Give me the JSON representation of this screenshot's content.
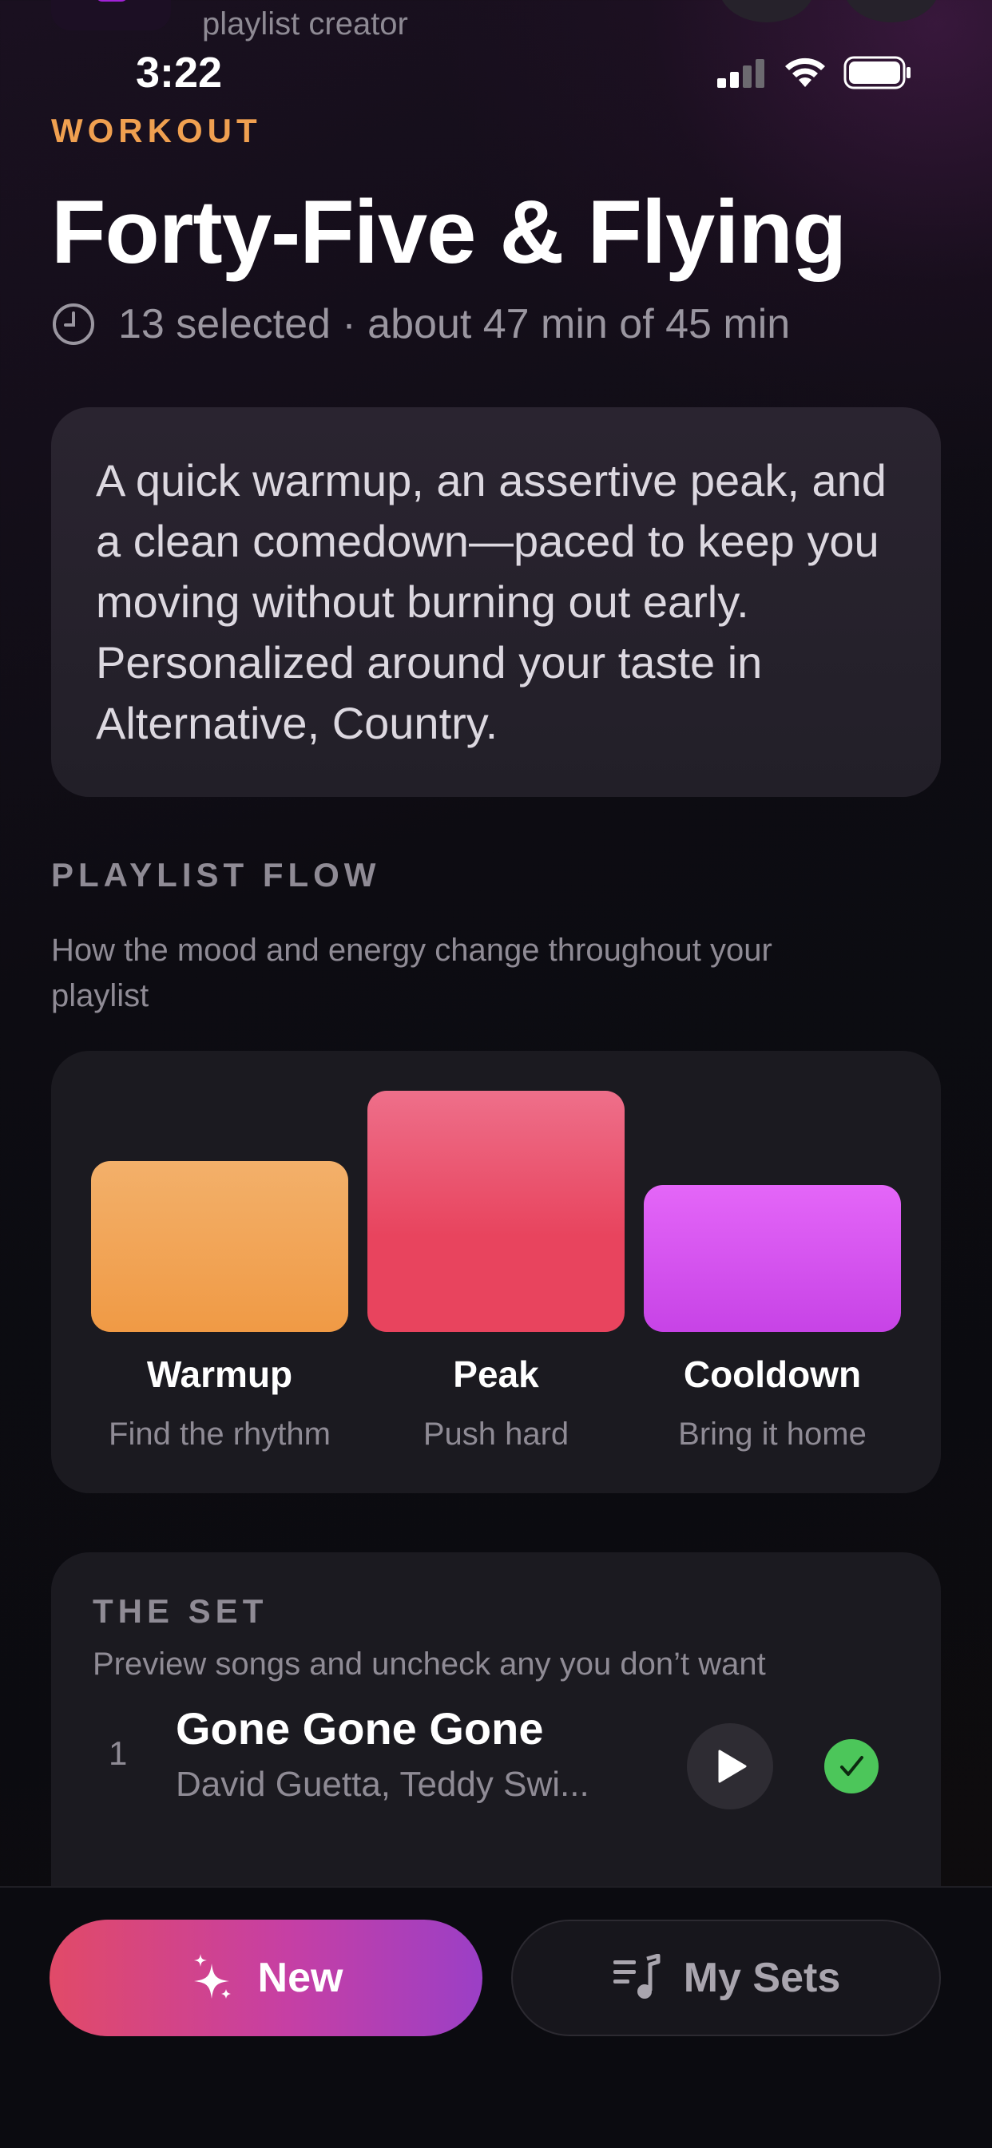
{
  "app": {
    "header_label": "playlist creator"
  },
  "status_bar": {
    "time": "3:22"
  },
  "playlist": {
    "category": "WORKOUT",
    "title": "Forty-Five & Flying",
    "meta": "13 selected · about 47 min of 45 min",
    "description": "A quick warmup, an assertive peak, and a clean comedown—paced to keep you moving without burning out early. Personalized around your taste in Alternative, Country."
  },
  "flow": {
    "label": "PLAYLIST FLOW",
    "subtitle": "How the mood and energy change throughout your playlist",
    "phases": [
      {
        "name": "Warmup",
        "caption": "Find the rhythm",
        "color": "#f0a050"
      },
      {
        "name": "Peak",
        "caption": "Push hard",
        "color": "#e8445e"
      },
      {
        "name": "Cooldown",
        "caption": "Bring it home",
        "color": "#d050f0"
      }
    ]
  },
  "set": {
    "label": "THE SET",
    "subtitle": "Preview songs and uncheck any you don’t want",
    "tracks": [
      {
        "number": "1",
        "title": "Gone Gone Gone",
        "artist": "David Guetta, Teddy Swi...",
        "checked": true
      }
    ]
  },
  "bottom_nav": {
    "new_label": "New",
    "sets_label": "My Sets"
  },
  "colors": {
    "accent_orange": "#f0a050",
    "check_green": "#4cc65a"
  }
}
